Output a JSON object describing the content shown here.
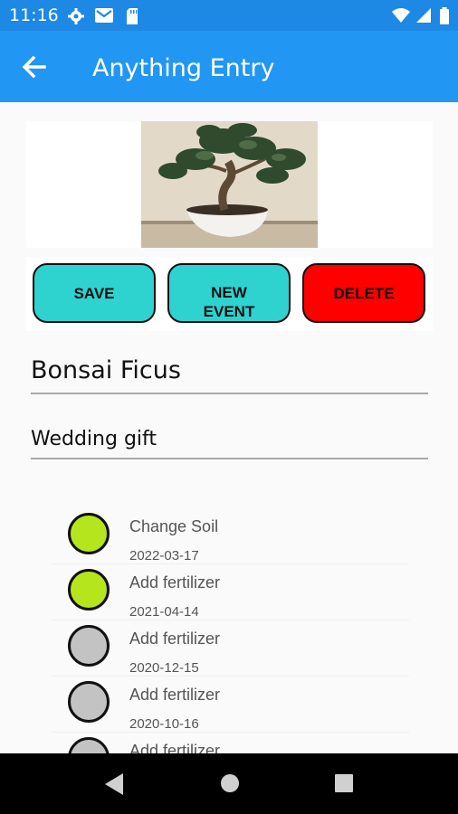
{
  "status_bar": {
    "time": "11:16",
    "icons": [
      "gear-icon",
      "gmail-icon",
      "sd-card-icon",
      "wifi-icon",
      "signal-icon",
      "battery-icon"
    ]
  },
  "app_bar": {
    "title": "Anything Entry",
    "back_icon": "arrow-back-icon",
    "color": "#2196f3"
  },
  "photo": {
    "subject": "bonsai-photo"
  },
  "buttons": {
    "save": "SAVE",
    "new_event": "NEW EVENT",
    "delete": "DELETE"
  },
  "colors": {
    "button_teal": "#2ed3cf",
    "button_delete": "#ff0000",
    "dot_active": "#b5e61d",
    "dot_inactive": "#c3c3c3"
  },
  "entry": {
    "name": "Bonsai Ficus",
    "description": "Wedding gift"
  },
  "events": [
    {
      "title": "Change Soil",
      "date": "2022-03-17",
      "status": "active"
    },
    {
      "title": "Add fertilizer",
      "date": "2021-04-14",
      "status": "active"
    },
    {
      "title": "Add fertilizer",
      "date": "2020-12-15",
      "status": "inactive"
    },
    {
      "title": "Add fertilizer",
      "date": "2020-10-16",
      "status": "inactive"
    },
    {
      "title": "Add fertilizer",
      "date": "",
      "status": "inactive"
    }
  ],
  "nav_bar": {
    "icons": [
      "back-triangle-icon",
      "home-circle-icon",
      "recents-square-icon"
    ]
  }
}
